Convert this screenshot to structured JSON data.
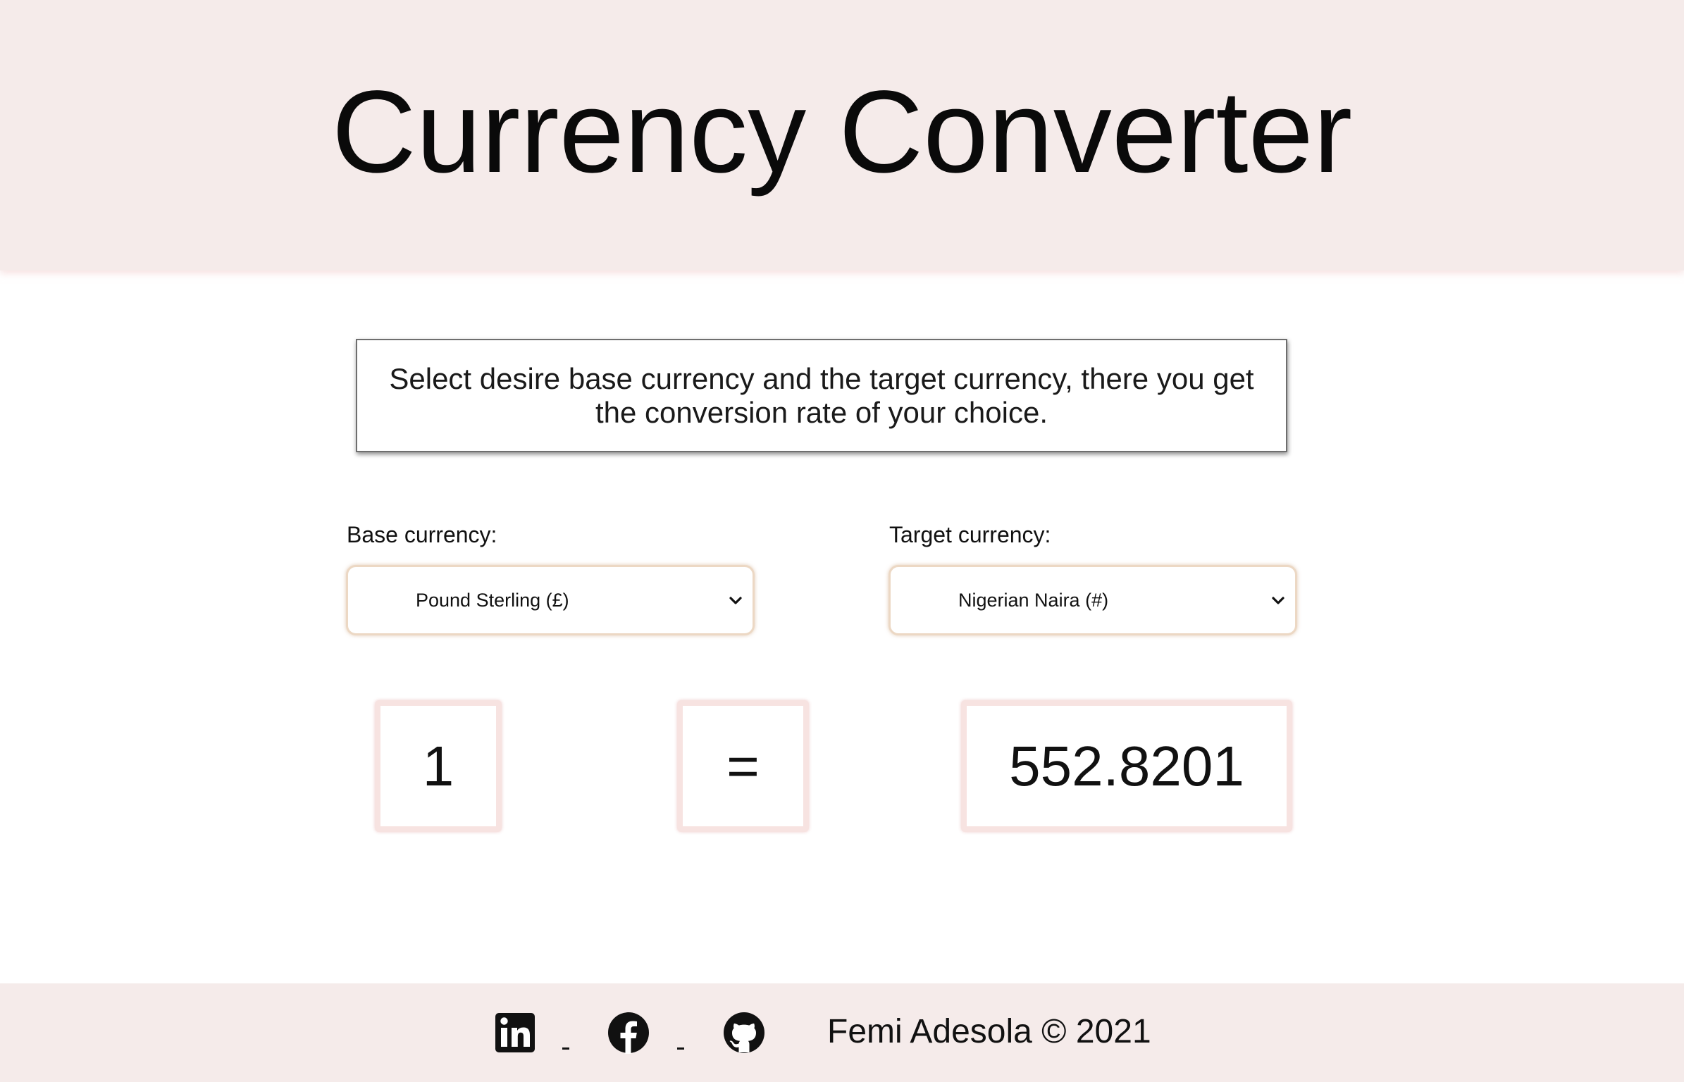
{
  "header": {
    "title": "Currency Converter"
  },
  "instructions": {
    "text": "Select desire base currency and the target currency, there you get the conversion rate of your choice."
  },
  "form": {
    "base_label": "Base currency:",
    "base_selected": "Pound Sterling (£)",
    "target_label": "Target currency:",
    "target_selected": "Nigerian Naira (#)"
  },
  "conversion": {
    "amount": "1",
    "equals": "=",
    "result": "552.8201"
  },
  "footer": {
    "social": [
      {
        "name": "linkedin-icon"
      },
      {
        "name": "facebook-icon"
      },
      {
        "name": "github-icon"
      }
    ],
    "credits": "Femi Adesola © 2021"
  },
  "colors": {
    "header_bg": "#f5ebea",
    "footer_bg": "#f5ebea",
    "select_border": "#ecd8c4",
    "value_border": "#f7e3e1"
  }
}
